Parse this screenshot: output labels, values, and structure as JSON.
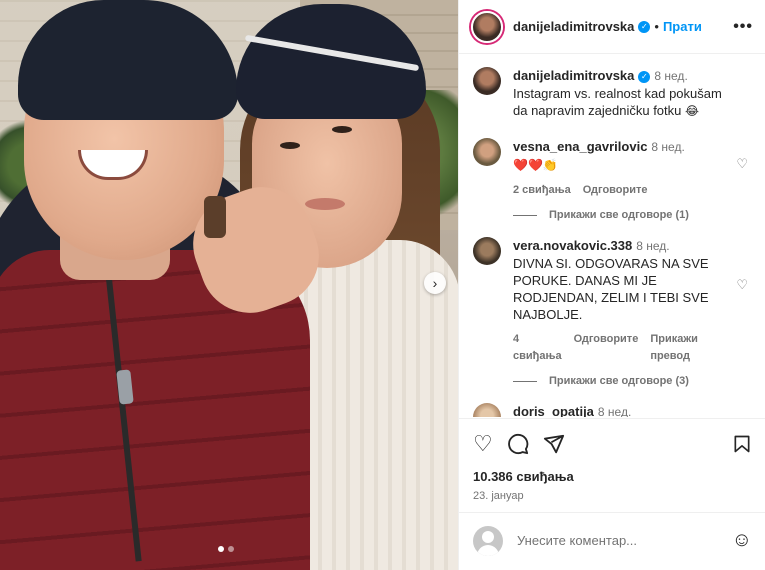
{
  "post": {
    "author": "danijeladimitrovska",
    "separator": "•",
    "follow_label": "Прати",
    "more_label": "•••",
    "verified_mark": "✓"
  },
  "caption": {
    "user": "danijeladimitrovska",
    "time": "8 нед.",
    "text": "Instagram vs. realnost kad pokušam da napravim zajedničku fotku",
    "emoji": "😂"
  },
  "comments": [
    {
      "user": "vesna_ena_gavrilovic",
      "time": "8 нед.",
      "text": "❤️❤️👏",
      "likes": "2 свиђања",
      "reply_label": "Одговорите",
      "view_replies": "Прикажи све одговоре (1)"
    },
    {
      "user": "vera.novakovic.338",
      "time": "8 нед.",
      "text": "DIVNA SI. ODGOVARAS NA SVE PORUKE. DANAS MI JE RODJENDAN, ZELIM I TEBI SVE NAJBOLJE.",
      "likes": "4 свиђања",
      "reply_label": "Одговорите",
      "translate_label": "Прикажи превод",
      "view_replies": "Прикажи све одговоре (3)"
    },
    {
      "user": "doris_opatija",
      "time": "8 нед."
    }
  ],
  "actions": {
    "likes": "10.386 свиђања",
    "date": "23. јануар"
  },
  "add_comment": {
    "placeholder": "Унесите коментар..."
  },
  "icons": {
    "like": "heart-icon",
    "comment": "comment-icon",
    "share": "share-icon",
    "save": "bookmark-icon",
    "emoji": "emoji-icon",
    "next": "chevron-right-icon"
  },
  "colors": {
    "accent": "#0095f6",
    "muted": "#737373"
  }
}
